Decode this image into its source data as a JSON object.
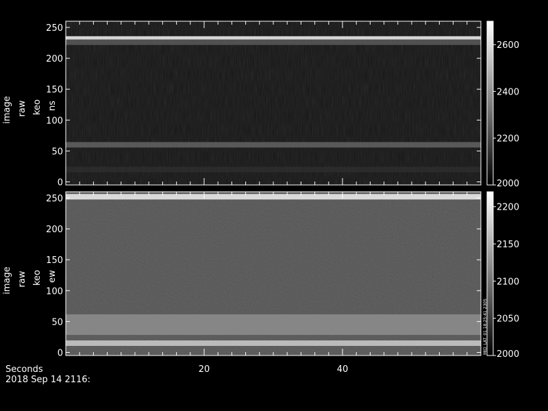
{
  "footer": {
    "x_label": "Seconds",
    "date_label": "2018 Sep 14 2116:"
  },
  "stamp": "MID_LAT_01 18:25:41 2305",
  "chart_data": [
    {
      "type": "heatmap",
      "ylabel_lines": [
        "image",
        "raw",
        "keo",
        "ns"
      ],
      "xlim": [
        0,
        60
      ],
      "ylim": [
        -5,
        260
      ],
      "x_ticks": [
        20,
        40
      ],
      "y_ticks": [
        0,
        50,
        100,
        150,
        200,
        250
      ],
      "colorbar": {
        "min": 2000,
        "max": 2700,
        "ticks": [
          2000,
          2200,
          2400,
          2600
        ]
      },
      "background_value": 2060,
      "bands": [
        {
          "y": 233,
          "value": 2640
        },
        {
          "y": 226,
          "value": 2240
        },
        {
          "y": 60,
          "value": 2260
        },
        {
          "y": 20,
          "value": 2120
        }
      ]
    },
    {
      "type": "heatmap",
      "ylabel_lines": [
        "image",
        "raw",
        "keo",
        "ew"
      ],
      "xlim": [
        0,
        60
      ],
      "ylim": [
        -5,
        260
      ],
      "x_ticks": [
        20,
        40
      ],
      "y_ticks": [
        0,
        50,
        100,
        150,
        200,
        250
      ],
      "colorbar": {
        "min": 2000,
        "max": 2220,
        "ticks": [
          2000,
          2050,
          2100,
          2150,
          2200
        ]
      },
      "background_value": 2070,
      "bands": [
        {
          "y": 252,
          "value": 2200
        },
        {
          "y": 15,
          "value": 2170
        },
        {
          "y": 45,
          "value": 2120
        }
      ]
    }
  ]
}
